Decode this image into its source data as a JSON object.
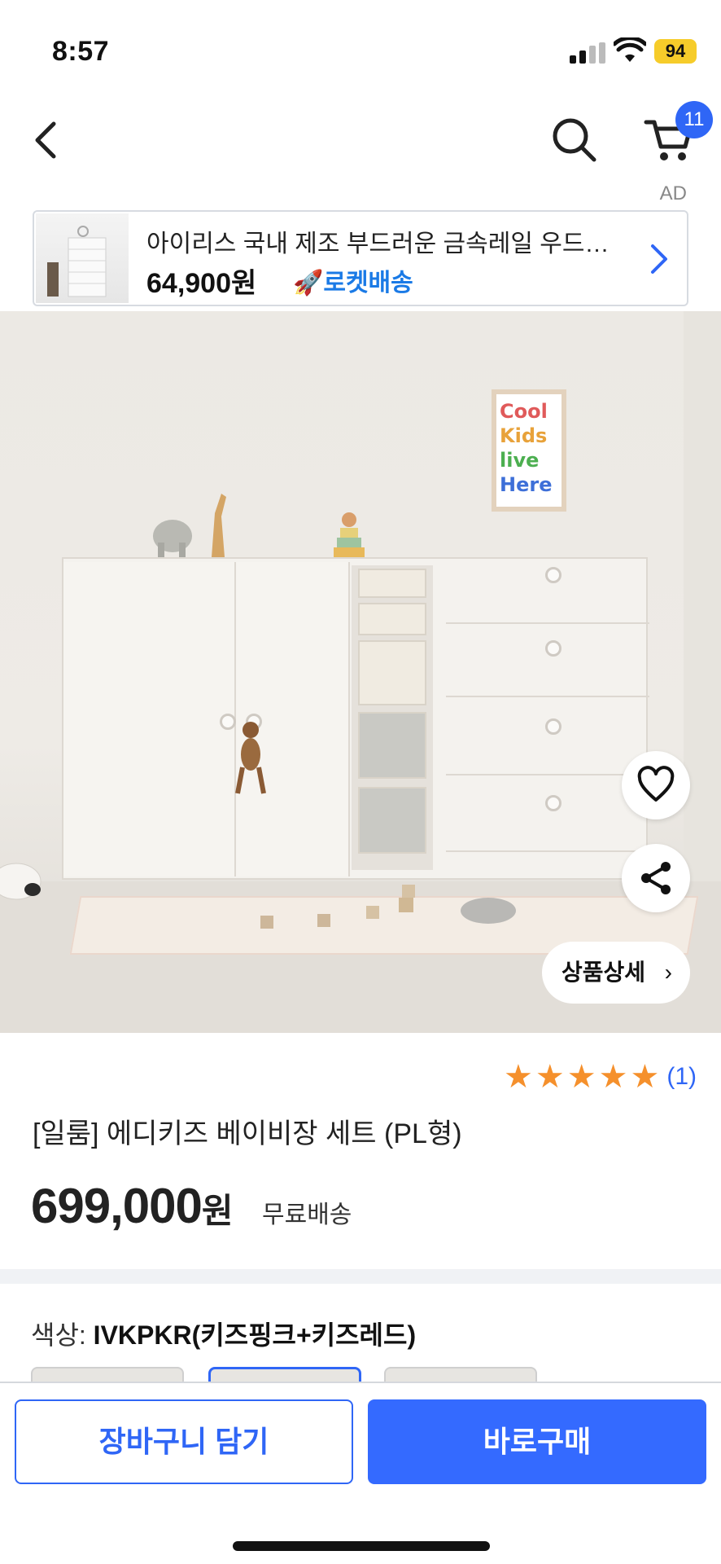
{
  "status_bar": {
    "time": "8:57",
    "battery": "94"
  },
  "header": {
    "cart_count": "11"
  },
  "ad": {
    "label": "AD",
    "title": "아이리스 국내 제조 부드러운 금속레일 우드…",
    "price": "64,900원",
    "delivery": "로켓배송"
  },
  "product": {
    "poster_text": [
      "Cool",
      "Kids",
      "live",
      "Here"
    ],
    "detail_button": "상품상세",
    "rating": {
      "stars": 5,
      "count": "(1)"
    },
    "name": "[일룸] 에디키즈 베이비장 세트 (PL형)",
    "price": "699,000",
    "price_unit": "원",
    "shipping": "무료배송"
  },
  "option": {
    "label": "색상:",
    "value": "IVKPKR(키즈핑크+키즈레드)"
  },
  "actions": {
    "add_to_cart": "장바구니 담기",
    "buy_now": "바로구매"
  },
  "colors": {
    "accent": "#346aff",
    "star": "#f5902c",
    "rocket": "#1a7ae6"
  }
}
